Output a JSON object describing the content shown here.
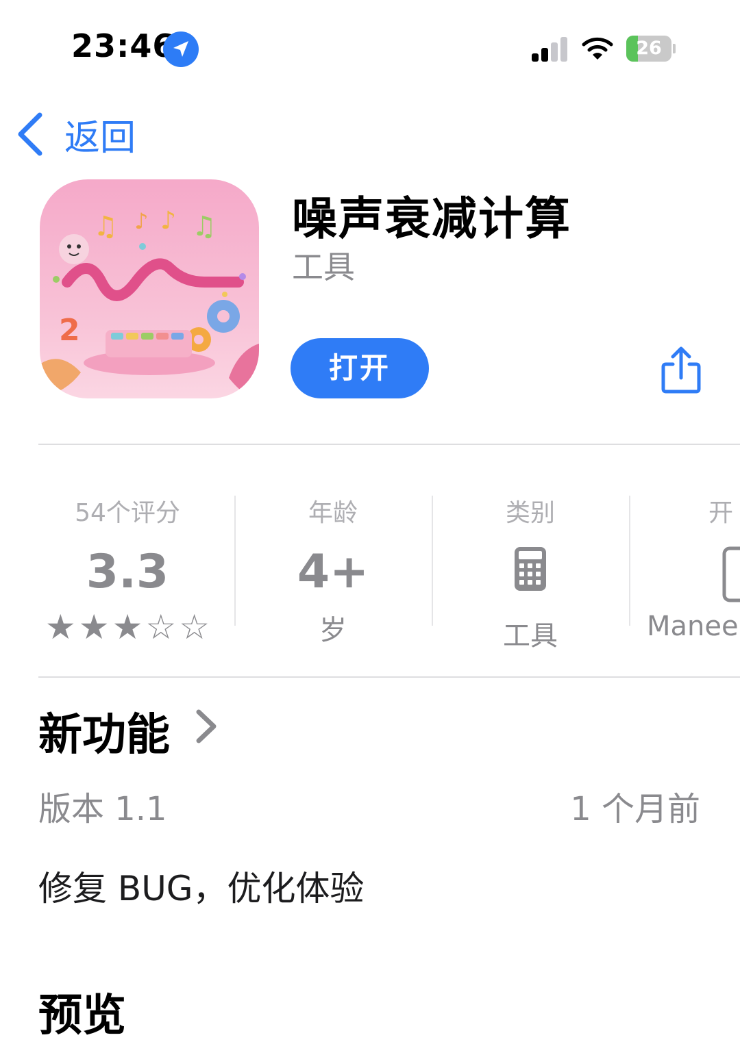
{
  "status_bar": {
    "time": "23:46",
    "battery": "26",
    "battery_level_percent": 26
  },
  "nav": {
    "back_label": "返回"
  },
  "app": {
    "name": "噪声衰减计算",
    "category": "工具",
    "open_label": "打开"
  },
  "info": {
    "ratings": {
      "label": "54个评分",
      "value": "3.3",
      "stars": 3,
      "max_stars": 5
    },
    "age": {
      "label": "年龄",
      "value": "4+",
      "unit": "岁"
    },
    "category": {
      "label": "类别",
      "icon": "calculator-icon",
      "value": "工具"
    },
    "developer": {
      "label": "开",
      "icon": "developer-icon",
      "value": "Manee"
    }
  },
  "whats_new": {
    "title": "新功能",
    "version": "版本 1.1",
    "date": "1 个月前",
    "notes": "修复 BUG，优化体验"
  },
  "preview": {
    "title": "预览"
  },
  "colors": {
    "accent": "#2f7cf6",
    "secondary_text": "#8a8a8e"
  }
}
